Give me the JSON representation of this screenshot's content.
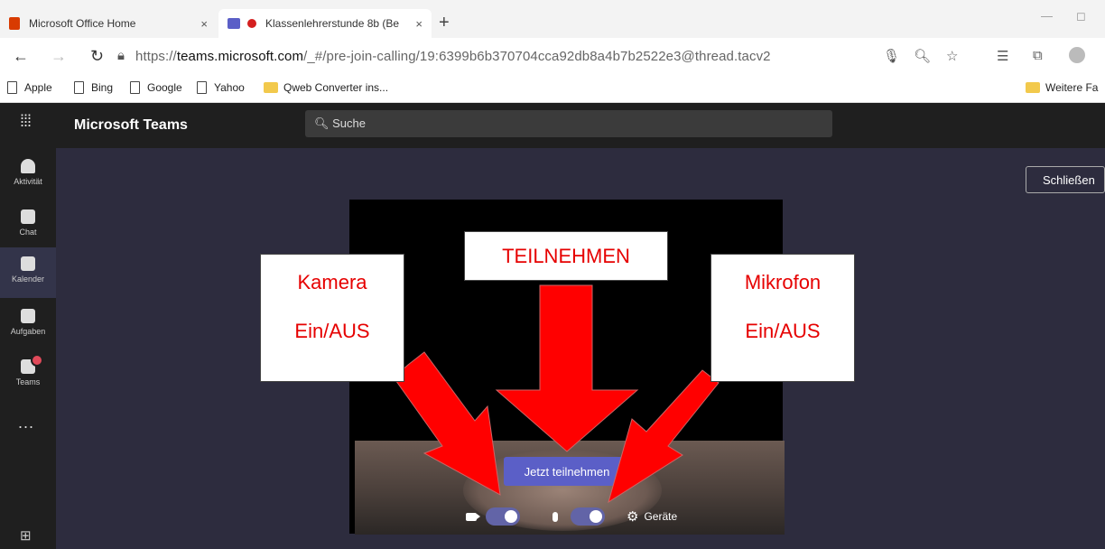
{
  "browser": {
    "tabs": [
      {
        "title": "Microsoft Office Home",
        "close": "×"
      },
      {
        "title": "Klassenlehrerstunde 8b (Be",
        "close": "×"
      }
    ],
    "new_tab": "+",
    "url_prefix": "https://",
    "url_host": "teams.microsoft.com",
    "url_path": "/_#/pre-join-calling/19:6399b6b370704cca92db8a4b7b2522e3@thread.tacv2",
    "bookmarks": [
      "Apple",
      "Bing",
      "Google",
      "Yahoo",
      "Qweb Converter ins..."
    ],
    "bookmarks_right": "Weitere Fa"
  },
  "teams": {
    "app_name": "Microsoft Teams",
    "search_placeholder": "Suche",
    "rail": [
      {
        "label": "Aktivität",
        "icon": "bell-icon"
      },
      {
        "label": "Chat",
        "icon": "chat-icon"
      },
      {
        "label": "Kalender",
        "icon": "calendar-icon"
      },
      {
        "label": "Aufgaben",
        "icon": "assignments-icon"
      },
      {
        "label": "Teams",
        "icon": "teams-icon"
      }
    ],
    "more": "...",
    "close_button": "Schließen",
    "join_button": "Jetzt teilnehmen",
    "devices_label": "Geräte",
    "camera_toggle_on": true,
    "mic_toggle_on": true
  },
  "annotations": {
    "camera_line1": "Kamera",
    "camera_line2": "Ein/AUS",
    "join": "TEILNEHMEN",
    "mic_line1": "Mikrofon",
    "mic_line2": "Ein/AUS",
    "arrow_color": "#ff0000"
  },
  "colors": {
    "teams_accent": "#5b5fc7",
    "stage_bg": "#2d2c3e",
    "header_bg": "#1f1f1f"
  }
}
